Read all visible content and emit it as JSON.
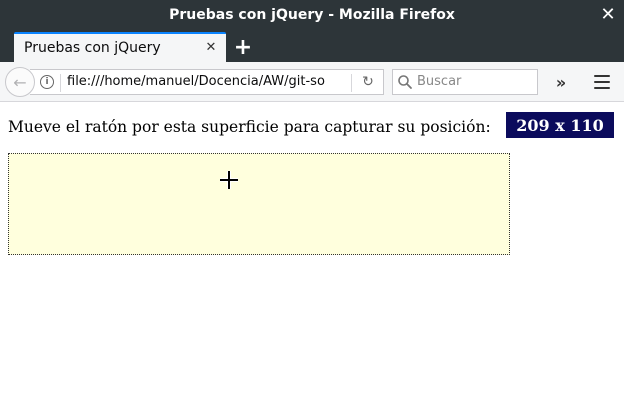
{
  "window": {
    "title": "Pruebas con jQuery - Mozilla Firefox",
    "close_glyph": "✕"
  },
  "tabs": [
    {
      "label": "Pruebas con jQuery",
      "close_glyph": "✕",
      "active": true
    }
  ],
  "new_tab_glyph": "+",
  "navbar": {
    "back_glyph": "←",
    "info_glyph": "i",
    "url": "file:///home/manuel/Docencia/AW/git-so",
    "reload_glyph": "↻",
    "search_placeholder": "Buscar",
    "overflow_glyph": "»"
  },
  "page": {
    "instruction": "Mueve el ratón por esta superficie para capturar su posición:",
    "position_readout": "209 x 110",
    "capture_area_color": "#ffffdd",
    "readout_bg_color": "#0b0b5c"
  },
  "icons": {
    "close": "close-icon",
    "back": "back-arrow-icon",
    "info": "info-icon",
    "reload": "reload-icon",
    "search": "search-icon",
    "overflow": "chevrons-right-icon",
    "menu": "hamburger-menu-icon",
    "cursor": "crosshair-cursor-icon"
  }
}
